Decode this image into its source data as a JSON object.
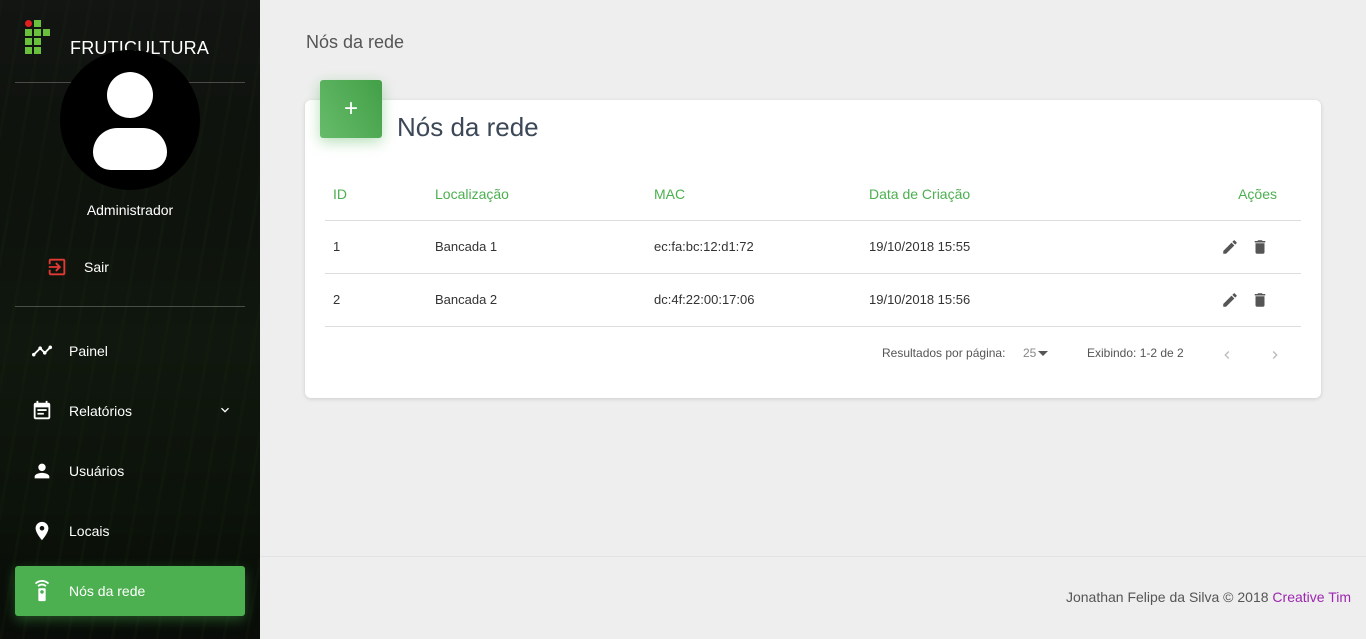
{
  "brand": {
    "name": "FRUTICULTURA"
  },
  "user": {
    "name": "Administrador",
    "logout_label": "Sair"
  },
  "sidebar": {
    "items": [
      {
        "label": "Painel",
        "icon": "timeline-icon"
      },
      {
        "label": "Relatórios",
        "icon": "calendar-icon",
        "has_children": true
      },
      {
        "label": "Usuários",
        "icon": "person-icon"
      },
      {
        "label": "Locais",
        "icon": "location-pin-icon"
      },
      {
        "label": "Nós da rede",
        "icon": "remote-device-icon",
        "active": true
      }
    ]
  },
  "header": {
    "title": "Nós da rede"
  },
  "card": {
    "title": "Nós da rede",
    "add_icon": "+",
    "columns": [
      "ID",
      "Localização",
      "MAC",
      "Data de Criação",
      "Ações"
    ],
    "rows": [
      {
        "id": "1",
        "location": "Bancada 1",
        "mac": "ec:fa:bc:12:d1:72",
        "created": "19/10/2018 15:55"
      },
      {
        "id": "2",
        "location": "Bancada 2",
        "mac": "dc:4f:22:00:17:06",
        "created": "19/10/2018 15:56"
      }
    ]
  },
  "pagination": {
    "per_page_label": "Resultados por página:",
    "per_page_value": "25",
    "showing": "Exibindo: 1-2 de 2"
  },
  "footer": {
    "text": "Jonathan Felipe da Silva © 2018 ",
    "link": "Creative Tim"
  },
  "colors": {
    "accent": "#4caf50",
    "footer_link": "#9c27b0",
    "logout_icon": "#e53935"
  }
}
